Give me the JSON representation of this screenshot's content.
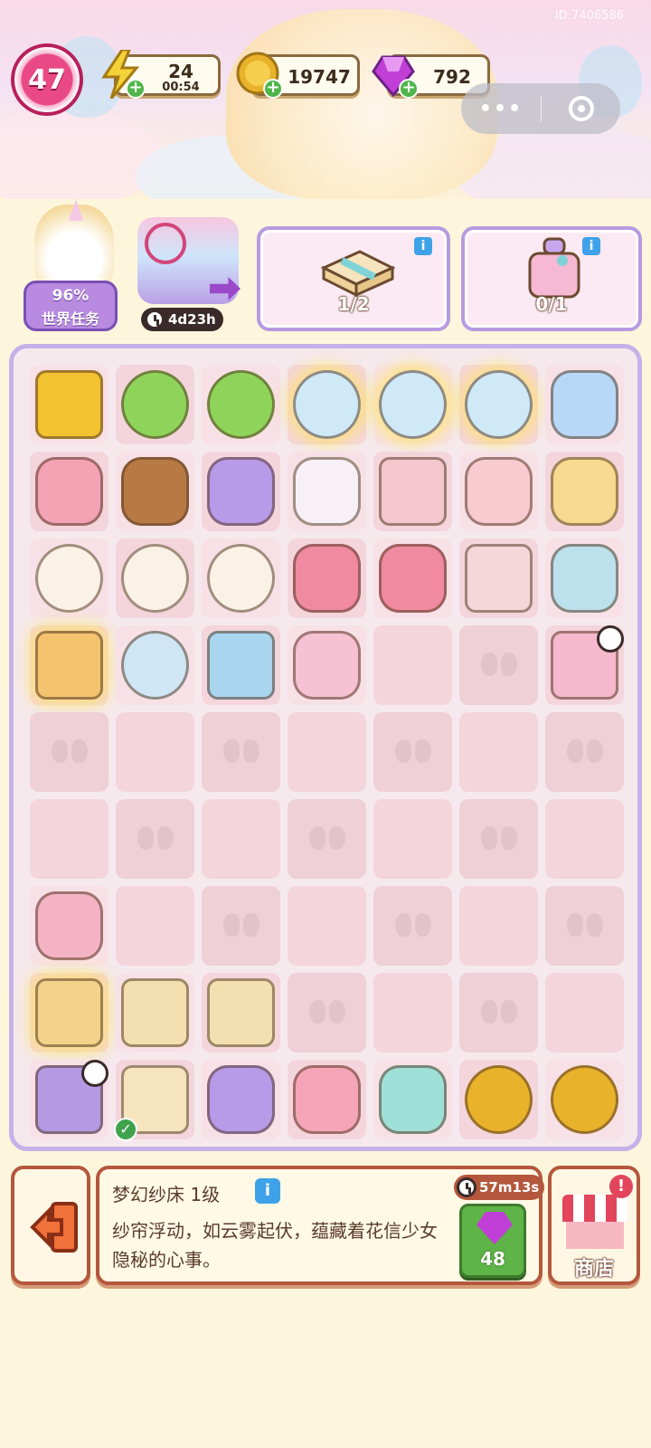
{
  "hud": {
    "level": "47",
    "energy": {
      "value": "24",
      "timer": "00:54"
    },
    "coins": {
      "value": "19747"
    },
    "gems": {
      "value": "792"
    },
    "watermark": "ID:7406586"
  },
  "mini_program_capsule": {
    "more_icon": "more-dots-icon",
    "close_icon": "target-close-icon"
  },
  "tasks": {
    "world_task": {
      "percent": "96%",
      "label": "世界任务"
    },
    "event": {
      "timer": "4d23h"
    },
    "orders": [
      {
        "progress": "1/2",
        "icon": "gift-box-icon"
      },
      {
        "progress": "0/1",
        "icon": "perfume-bottle-icon"
      }
    ]
  },
  "board": {
    "rows": [
      [
        {
          "item": "up-arrow-card-icon",
          "color": "#f2c230"
        },
        {
          "item": "green-lollipop-icon",
          "color": "#8fd45a"
        },
        {
          "item": "green-lollipop-icon",
          "color": "#8fd45a"
        },
        {
          "item": "energy-candy-jar-icon",
          "color": "#cfe9f7",
          "glow": true
        },
        {
          "item": "energy-candy-jar-icon",
          "color": "#cfe9f7",
          "glow": true
        },
        {
          "item": "energy-candy-jar-icon",
          "color": "#cfe9f7",
          "glow": true
        },
        {
          "item": "rainbow-cotton-candy-icon",
          "color": "#b7d8f6"
        }
      ],
      [
        {
          "item": "pink-teddy-bear-icon",
          "color": "#f4a3b4"
        },
        {
          "item": "brown-teddy-bear-icon",
          "color": "#b87a45"
        },
        {
          "item": "purple-teddy-bear-icon",
          "color": "#b79ae8"
        },
        {
          "item": "unicorn-plush-icon",
          "color": "#f7f1f7"
        },
        {
          "item": "pink-cabinet-icon",
          "color": "#f4c7cf"
        },
        {
          "item": "marshmallow-icon",
          "color": "#f8cbd1"
        },
        {
          "item": "rainbow-cotton-candy-icon",
          "color": "#f7d98f"
        }
      ],
      [
        {
          "item": "sheep-plush-icon",
          "color": "#fbf2e6"
        },
        {
          "item": "sheep-plush-icon",
          "color": "#fbf2e6"
        },
        {
          "item": "sheep-plush-icon",
          "color": "#fbf2e6"
        },
        {
          "item": "pink-castle-icon",
          "color": "#f08aa0"
        },
        {
          "item": "pink-castle-icon",
          "color": "#f08aa0"
        },
        {
          "item": "pink-drawer-icon",
          "color": "#f5d7da"
        },
        {
          "item": "rainbow-cotton-candy-icon",
          "color": "#bce1ec"
        }
      ],
      [
        {
          "item": "balloon-gift-box-icon",
          "color": "#f3c36e",
          "glow": true
        },
        {
          "item": "candy-jar-icon",
          "color": "#cfe6f4"
        },
        {
          "item": "candy-tray-icon",
          "color": "#a9d5ef"
        },
        {
          "item": "candy-bag-icon",
          "color": "#f6c2d3"
        },
        {
          "item": "empty"
        },
        {
          "item": "locked"
        },
        {
          "item": "pink-bed-icon",
          "color": "#f5b8cc",
          "timer": true
        }
      ],
      [
        {
          "item": "locked"
        },
        {
          "item": "empty"
        },
        {
          "item": "locked"
        },
        {
          "item": "empty"
        },
        {
          "item": "locked"
        },
        {
          "item": "empty"
        },
        {
          "item": "locked"
        }
      ],
      [
        {
          "item": "empty"
        },
        {
          "item": "locked"
        },
        {
          "item": "empty"
        },
        {
          "item": "locked"
        },
        {
          "item": "empty"
        },
        {
          "item": "locked"
        },
        {
          "item": "empty"
        }
      ],
      [
        {
          "item": "lint-roller-icon",
          "color": "#f4b3c4"
        },
        {
          "item": "empty"
        },
        {
          "item": "locked"
        },
        {
          "item": "empty"
        },
        {
          "item": "locked"
        },
        {
          "item": "empty"
        },
        {
          "item": "locked"
        }
      ],
      [
        {
          "item": "energy-gift-box-icon",
          "color": "#f3d38a",
          "glow": true
        },
        {
          "item": "folded-paper-icon",
          "color": "#f4dfb0"
        },
        {
          "item": "paper-scissors-icon",
          "color": "#f4dfb0"
        },
        {
          "item": "locked"
        },
        {
          "item": "empty"
        },
        {
          "item": "locked"
        },
        {
          "item": "empty"
        }
      ],
      [
        {
          "item": "toy-shop-building-icon",
          "color": "#b39ae2",
          "timer": true
        },
        {
          "item": "ribbon-gift-box-icon",
          "color": "#f6e4be",
          "check": true
        },
        {
          "item": "purple-teddy-bear-icon",
          "color": "#b79ae8"
        },
        {
          "item": "pink-bunny-plush-icon",
          "color": "#f6a5b8"
        },
        {
          "item": "seal-plush-icon",
          "color": "#9fe0d8"
        },
        {
          "item": "gold-coins-icon",
          "color": "#e8b22b"
        },
        {
          "item": "gold-coin-icon",
          "color": "#e8b22b"
        }
      ]
    ]
  },
  "selected_item": {
    "name": "梦幻纱床 1级",
    "description": "纱帘浮动，如云雾起伏，蕴藏着花信少女隐秘的心事。",
    "speedup_timer": "57m13s",
    "speedup_cost": "48"
  },
  "shop": {
    "label": "商店",
    "alert": "!"
  }
}
